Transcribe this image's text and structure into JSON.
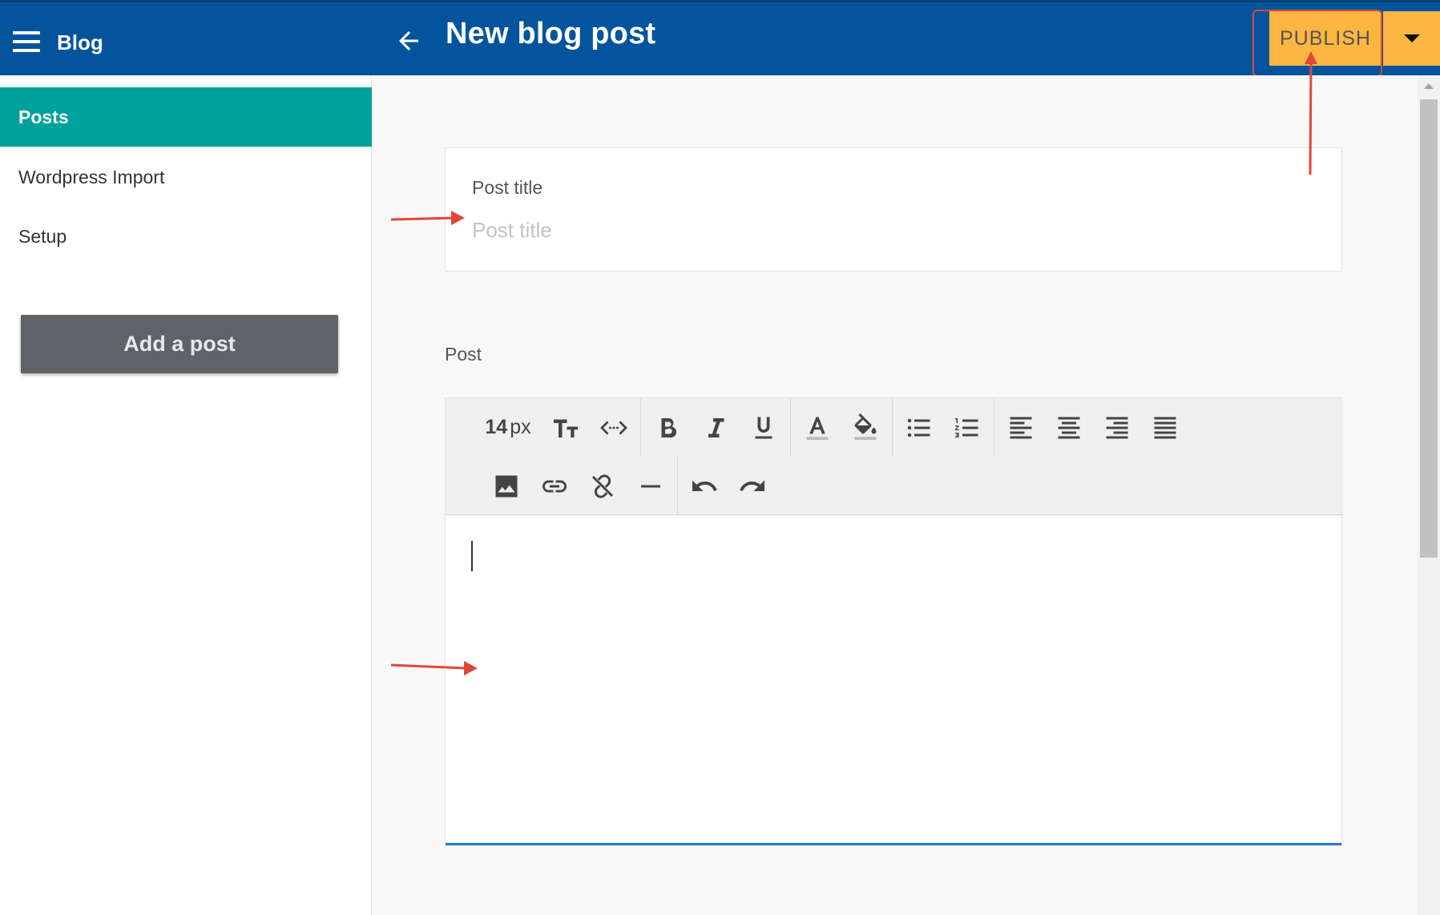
{
  "header": {
    "app_title": "Blog",
    "page_title": "New blog post",
    "publish_label": "PUBLISH"
  },
  "sidebar": {
    "items": [
      {
        "label": "Posts",
        "active": true
      },
      {
        "label": "Wordpress Import",
        "active": false
      },
      {
        "label": "Setup",
        "active": false
      }
    ],
    "add_post_label": "Add a post"
  },
  "form": {
    "title_label": "Post title",
    "title_placeholder": "Post title",
    "title_value": "",
    "post_label": "Post"
  },
  "toolbar": {
    "font_size_value": "14",
    "font_size_unit": "px",
    "row1_icons": [
      "text-size-icon",
      "code-icon",
      "bold-icon",
      "italic-icon",
      "underline-icon",
      "font-color-icon",
      "fill-color-icon",
      "bullet-list-icon",
      "numbered-list-icon",
      "align-left-icon",
      "align-center-icon",
      "align-right-icon",
      "align-justify-icon"
    ],
    "row2_icons": [
      "image-icon",
      "link-icon",
      "unlink-icon",
      "horizontal-rule-icon",
      "undo-icon",
      "redo-icon"
    ]
  },
  "colors": {
    "topbar": "#03549d",
    "publish": "#fdb642",
    "active_item": "#00a19a",
    "add_post_button": "#5f6367",
    "annotation": "#e0483a",
    "editor_focus": "#2a78d4"
  }
}
